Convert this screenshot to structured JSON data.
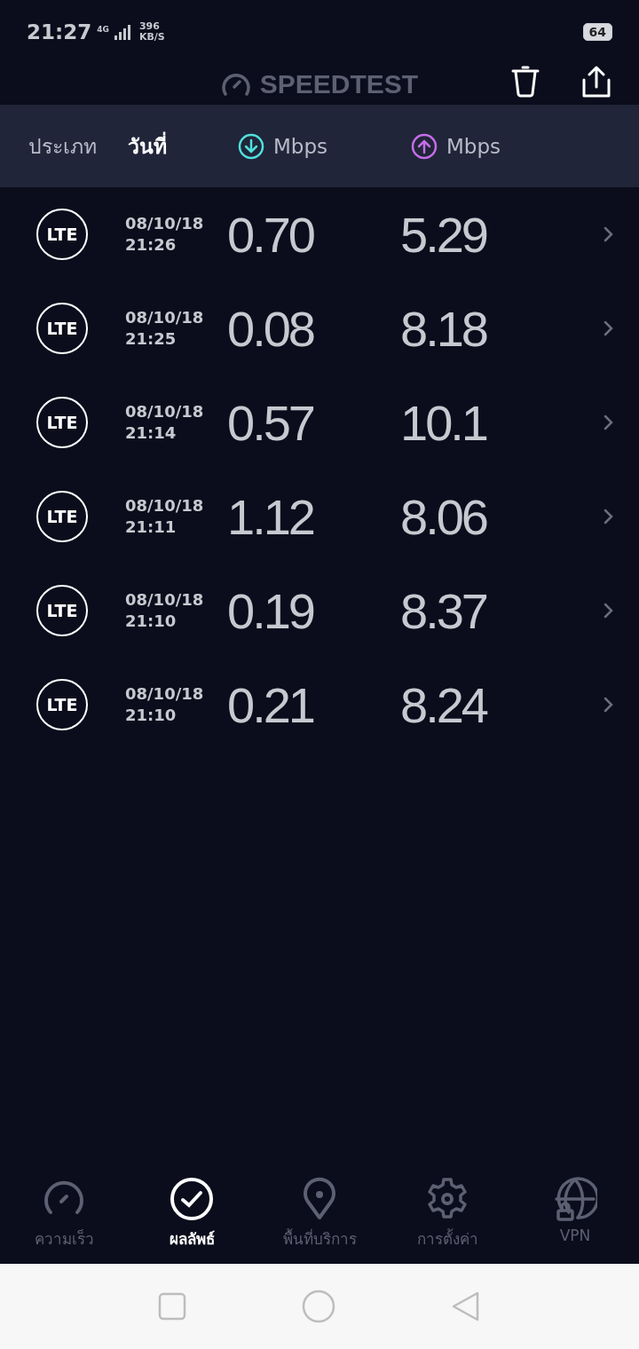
{
  "status_bar": {
    "time": "21:27",
    "network": "4G",
    "speed_value": "396",
    "speed_unit": "KB/S",
    "battery": "64"
  },
  "app_bar": {
    "title": "SPEEDTEST"
  },
  "columns": [
    {
      "label": "ประเภท",
      "kind": "text",
      "selected": false
    },
    {
      "label": "วันที่",
      "kind": "text",
      "selected": true
    },
    {
      "label": "Mbps",
      "kind": "download",
      "selected": false
    },
    {
      "label": "Mbps",
      "kind": "upload",
      "selected": false
    }
  ],
  "results": [
    {
      "type": "LTE",
      "date": "08/10/18",
      "time": "21:26",
      "download": "0.70",
      "upload": "5.29"
    },
    {
      "type": "LTE",
      "date": "08/10/18",
      "time": "21:25",
      "download": "0.08",
      "upload": "8.18"
    },
    {
      "type": "LTE",
      "date": "08/10/18",
      "time": "21:14",
      "download": "0.57",
      "upload": "10.1"
    },
    {
      "type": "LTE",
      "date": "08/10/18",
      "time": "21:11",
      "download": "1.12",
      "upload": "8.06"
    },
    {
      "type": "LTE",
      "date": "08/10/18",
      "time": "21:10",
      "download": "0.19",
      "upload": "8.37"
    },
    {
      "type": "LTE",
      "date": "08/10/18",
      "time": "21:10",
      "download": "0.21",
      "upload": "8.24"
    }
  ],
  "bottom_nav": [
    {
      "label": "ความเร็ว",
      "kind": "speed",
      "selected": false
    },
    {
      "label": "ผลลัพธ์",
      "kind": "results",
      "selected": true
    },
    {
      "label": "พื้นที่บริการ",
      "kind": "map",
      "selected": false
    },
    {
      "label": "การตั้งค่า",
      "kind": "settings",
      "selected": false
    },
    {
      "label": "VPN",
      "kind": "vpn",
      "selected": false
    }
  ]
}
